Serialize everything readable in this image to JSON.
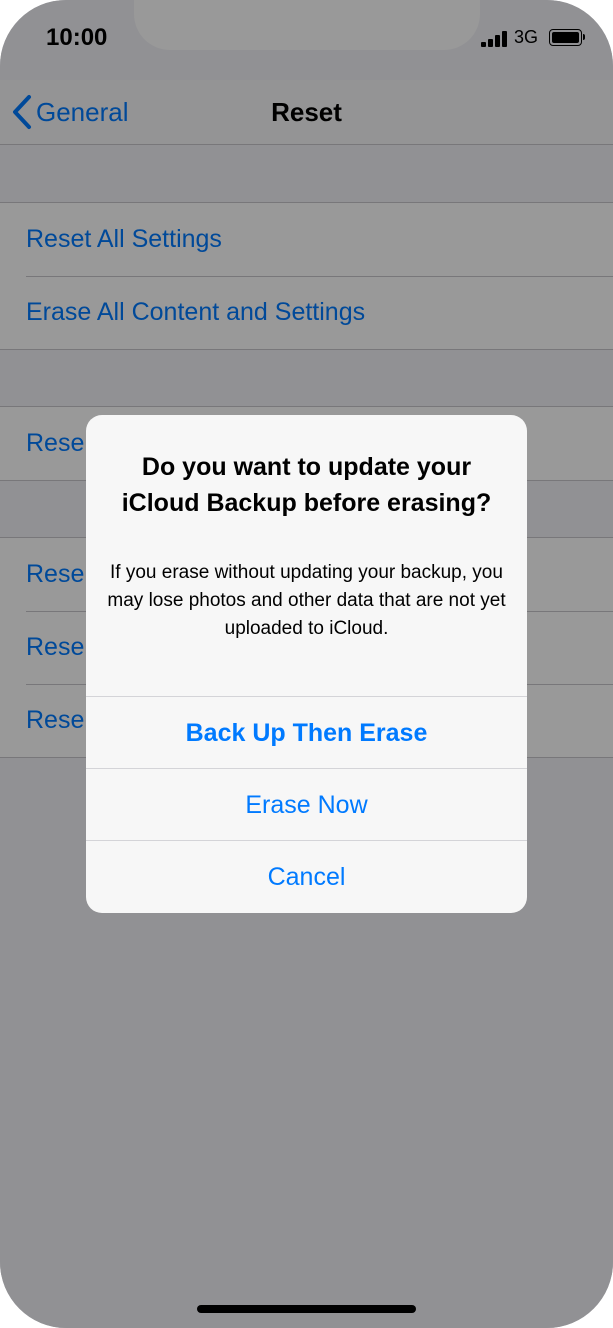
{
  "status_bar": {
    "time": "10:00",
    "network": "3G",
    "signal_icon": "cellular-signal-icon",
    "battery_icon": "battery-icon"
  },
  "nav": {
    "back_label": "General",
    "back_icon": "chevron-left-icon",
    "title": "Reset"
  },
  "groups": [
    {
      "rows": [
        "Reset All Settings",
        "Erase All Content and Settings"
      ]
    },
    {
      "rows": [
        "Rese"
      ]
    },
    {
      "rows": [
        "Rese",
        "Rese",
        "Rese"
      ]
    }
  ],
  "alert": {
    "title": "Do you want to update your iCloud Backup before erasing?",
    "message": "If you erase without updating your backup, you may lose photos and other data that are not yet uploaded to iCloud.",
    "buttons": {
      "backup": "Back Up Then Erase",
      "erase_now": "Erase Now",
      "cancel": "Cancel"
    }
  },
  "colors": {
    "accent": "#007aff",
    "overlay": "#8e8e92"
  }
}
